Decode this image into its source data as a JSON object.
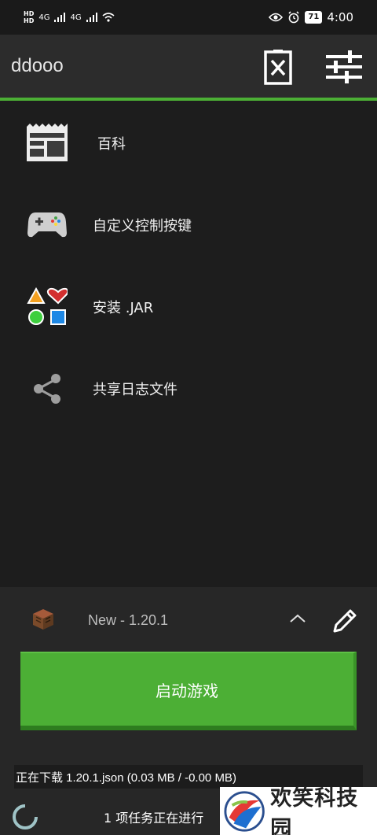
{
  "status_bar": {
    "hd1": "HD",
    "hd2": "HD",
    "net1": "4G",
    "net2": "4G",
    "battery": "71",
    "time": "4:00"
  },
  "app_bar": {
    "title": "ddooo",
    "accent_color": "#4caf35"
  },
  "menu": {
    "items": [
      {
        "label": "百科",
        "icon": "newspaper-icon"
      },
      {
        "label": "自定义控制按键",
        "icon": "gamepad-icon"
      },
      {
        "label": "安装 .JAR",
        "icon": "shapes-icon"
      },
      {
        "label": "共享日志文件",
        "icon": "share-icon"
      }
    ]
  },
  "version": {
    "label": "New - 1.20.1",
    "icon": "crafting-table-icon"
  },
  "launch": {
    "label": "启动游戏"
  },
  "download": {
    "status": "正在下载 1.20.1.json (0.03 MB / -0.00 MB)"
  },
  "tasks": {
    "label": "1 项任务正在进行"
  },
  "watermark": {
    "text": "欢笑科技园"
  }
}
